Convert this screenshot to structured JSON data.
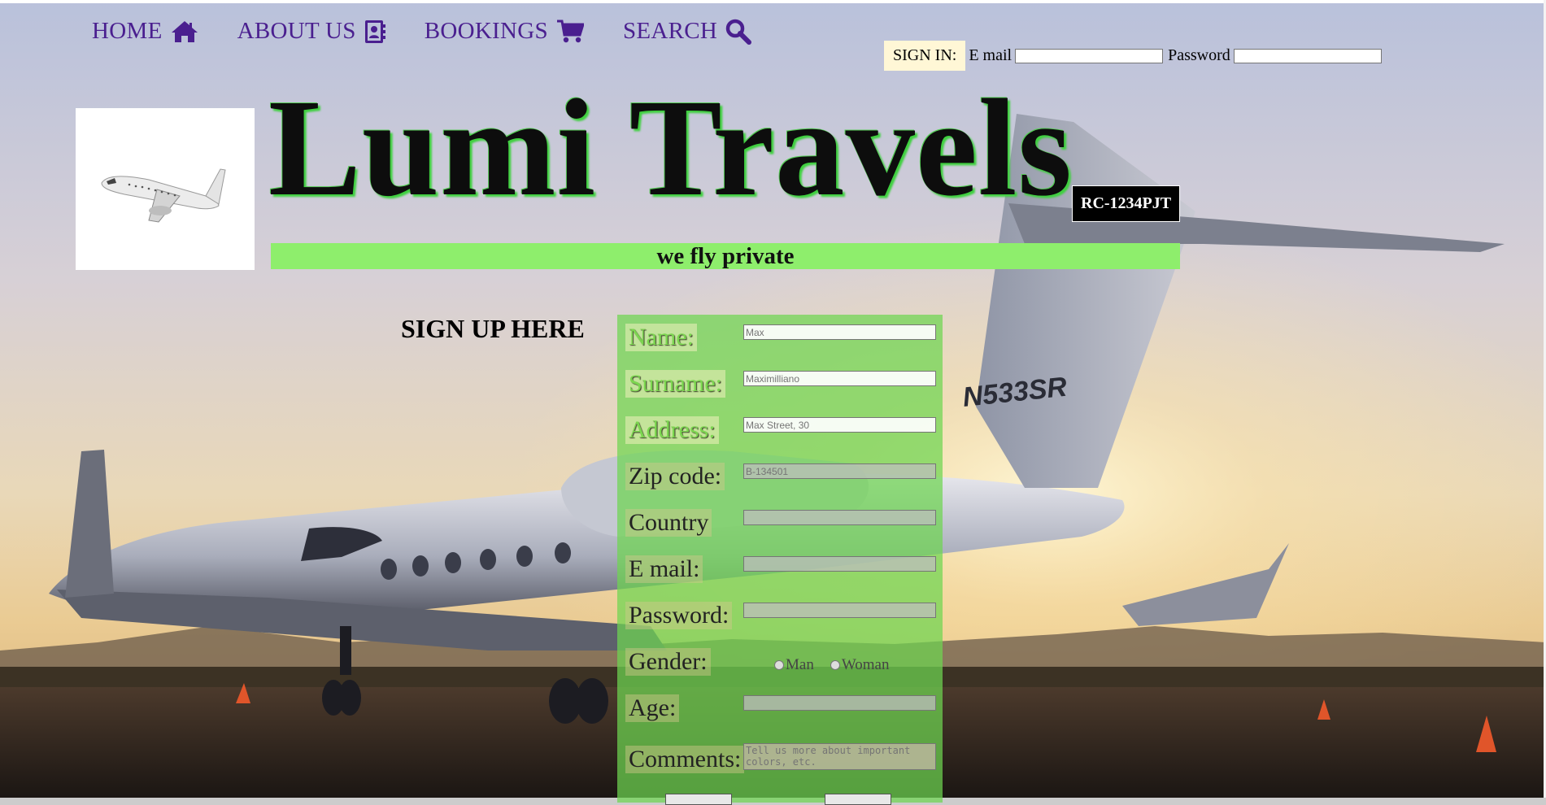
{
  "nav": {
    "items": [
      {
        "label": "HOME",
        "icon": "home-icon"
      },
      {
        "label": "ABOUT US",
        "icon": "contact-book-icon"
      },
      {
        "label": "BOOKINGS",
        "icon": "shopping-cart-icon"
      },
      {
        "label": "SEARCH",
        "icon": "search-icon"
      }
    ]
  },
  "signin": {
    "button_label": "SIGN IN:",
    "email_label": "E mail",
    "password_label": "Password",
    "email_value": "",
    "password_value": ""
  },
  "header": {
    "title": "Lumi Travels",
    "code": "RC-1234PJT",
    "tagline": "we fly private"
  },
  "signup": {
    "heading": "SIGN UP HERE",
    "fields": {
      "name": {
        "label": "Name:",
        "placeholder": "Max"
      },
      "surname": {
        "label": "Surname:",
        "placeholder": "Maximilliano"
      },
      "address": {
        "label": "Address:",
        "placeholder": "Max Street, 30"
      },
      "zip": {
        "label": "Zip code:",
        "placeholder": "B-134501"
      },
      "country": {
        "label": "Country",
        "placeholder": ""
      },
      "email": {
        "label": "E mail:",
        "placeholder": ""
      },
      "password": {
        "label": "Password:",
        "placeholder": ""
      },
      "gender": {
        "label": "Gender:",
        "options": [
          "Man",
          "Woman"
        ]
      },
      "age": {
        "label": "Age:",
        "placeholder": ""
      },
      "comments": {
        "label": "Comments:",
        "placeholder": "Tell us more about important colors, etc."
      }
    }
  },
  "background": {
    "tail_number": "N533SR"
  },
  "colors": {
    "nav": "#4a1f8f",
    "accent_green": "#8eee6c",
    "form_panel": "#6ed650",
    "signin_bg": "#fff7d6"
  }
}
